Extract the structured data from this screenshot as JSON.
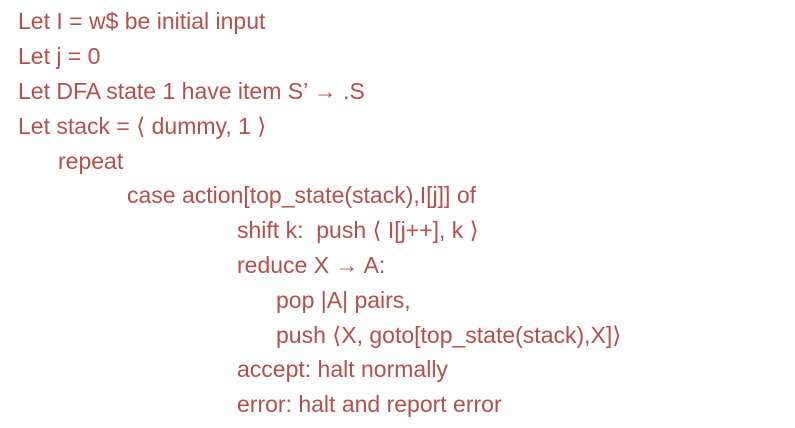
{
  "algorithm": {
    "lines": [
      "Let I = w$ be initial input",
      "Let j = 0",
      "Let DFA state 1 have item S’ → .S",
      "Let stack = ⟨ dummy, 1 ⟩",
      "repeat",
      "case action[top_state(stack),I[j]] of",
      "shift k:  push ⟨ I[j++], k ⟩",
      "reduce X → A:",
      "pop |A| pairs,",
      "push ⟨X, goto[top_state(stack),X]⟩",
      "accept: halt normally",
      "error: halt and report error"
    ]
  },
  "colors": {
    "text": "#b4504b",
    "background": "#ffffff"
  }
}
